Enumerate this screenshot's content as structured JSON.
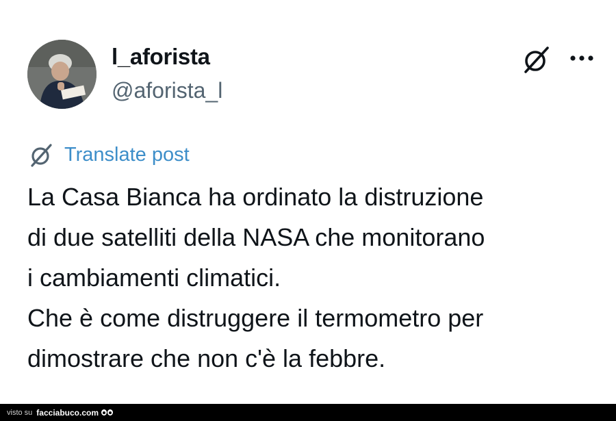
{
  "post": {
    "display_name": "l_aforista",
    "handle": "@aforista_l",
    "translate_label": "Translate post",
    "text_lines": [
      "La Casa Bianca ha ordinato la distruzione",
      "di due satelliti della NASA che monitorano",
      "i cambiamenti climatici.",
      "Che è come distruggere il termometro per",
      "dimostrare che non c'è la febbre."
    ]
  },
  "icons": {
    "grok": "grok-icon",
    "more": "more-horizontal-icon",
    "translate": "grok-translate-icon"
  },
  "footer": {
    "prefix": "visto su",
    "brand": "facciabuco.com"
  },
  "colors": {
    "text": "#0f1419",
    "secondary": "#536471",
    "link": "#3d8ec9",
    "footer_bg": "#000000"
  }
}
